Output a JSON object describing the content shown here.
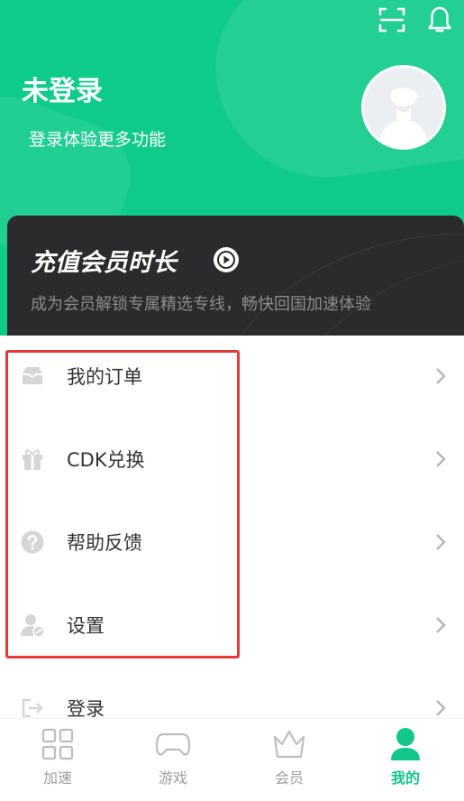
{
  "header": {
    "title": "未登录",
    "subtitle": "登录体验更多功能"
  },
  "vip": {
    "title": "充值会员时长",
    "subtitle": "成为会员解锁专属精选专线，畅快回国加速体验"
  },
  "menu": [
    {
      "label": "我的订单",
      "icon": "inbox-icon"
    },
    {
      "label": "CDK兑换",
      "icon": "gift-icon"
    },
    {
      "label": "帮助反馈",
      "icon": "help-icon"
    },
    {
      "label": "设置",
      "icon": "user-settings-icon"
    },
    {
      "label": "登录",
      "icon": "login-arrow-icon"
    }
  ],
  "tabs": [
    {
      "label": "加速",
      "icon": "grid-icon",
      "active": false
    },
    {
      "label": "游戏",
      "icon": "gamepad-icon",
      "active": false
    },
    {
      "label": "会员",
      "icon": "crown-icon",
      "active": false
    },
    {
      "label": "我的",
      "icon": "profile-icon",
      "active": true
    }
  ],
  "colors": {
    "brand_green": "#0fcb8a",
    "active_tab": "#13c78a",
    "card_dark": "#2b2b2d",
    "highlight": "#e53935"
  }
}
